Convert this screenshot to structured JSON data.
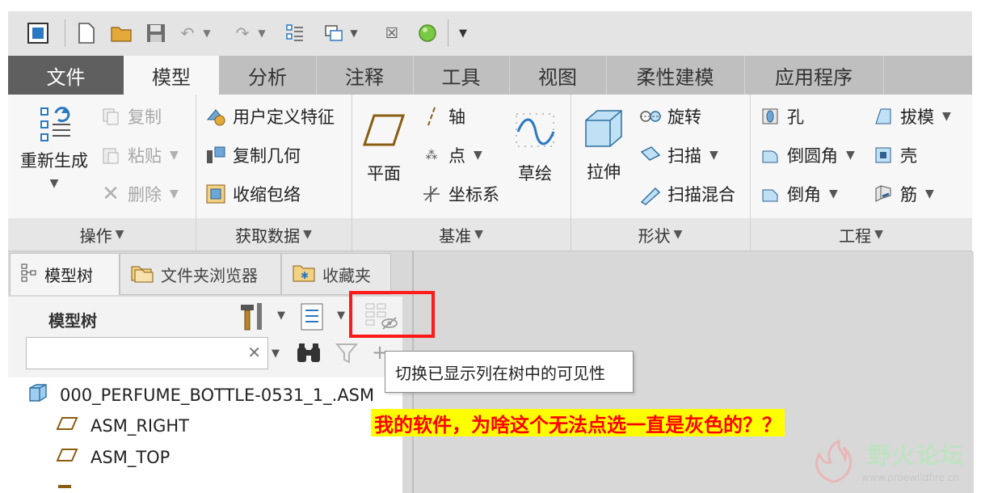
{
  "tabs": [
    "文件",
    "模型",
    "分析",
    "注释",
    "工具",
    "视图",
    "柔性建模",
    "应用程序"
  ],
  "groups": {
    "operations": {
      "label": "操作",
      "regenerate": "重新生成",
      "copy": "复制",
      "paste": "粘贴",
      "delete": "删除"
    },
    "get_data": {
      "label": "获取数据",
      "user_defined_feature": "用户定义特征",
      "copy_geometry": "复制几何",
      "shrinkwrap": "收缩包络"
    },
    "datum": {
      "label": "基准",
      "plane": "平面",
      "axis": "轴",
      "point": "点",
      "coord_sys": "坐标系",
      "sketch": "草绘"
    },
    "shapes": {
      "label": "形状",
      "extrude": "拉伸",
      "revolve": "旋转",
      "sweep": "扫描",
      "swept_blend": "扫描混合"
    },
    "engineering": {
      "label": "工程",
      "hole": "孔",
      "draft": "拔模",
      "round": "倒圆角",
      "shell": "壳",
      "chamfer": "倒角",
      "rib": "筋"
    }
  },
  "nav_tabs": [
    "模型树",
    "文件夹浏览器",
    "收藏夹"
  ],
  "model_tree": {
    "title": "模型树",
    "search_value": "",
    "items": [
      "000_PERFUME_BOTTLE-0531_1_.ASM",
      "ASM_RIGHT",
      "ASM_TOP"
    ]
  },
  "tooltip": "切换已显示列在树中的可见性",
  "annotation": "我的软件，为啥这个无法点选一直是灰色的？？",
  "watermark": {
    "title": "野火论坛",
    "url": "www.proewildfire.cn"
  },
  "colors": {
    "file_tab": "#5f5f5f",
    "highlight_box": "#ff1a1a",
    "annotation_bg": "#ffff00",
    "annotation_text": "#ff0000"
  }
}
